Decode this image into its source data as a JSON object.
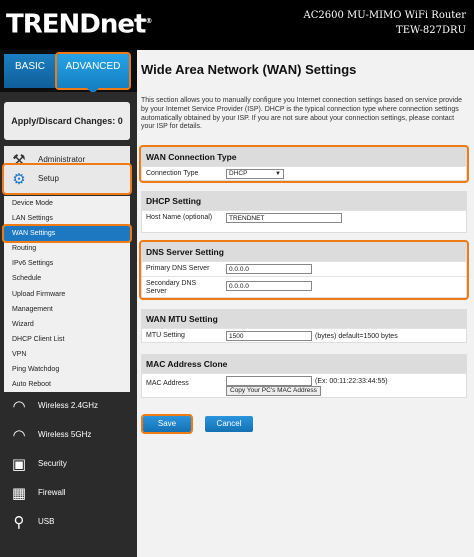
{
  "header": {
    "logo": "TRENDnet",
    "model_name": "AC2600 MU-MIMO WiFi Router",
    "model_number": "TEW-827DRU"
  },
  "tabs": {
    "basic": "BASIC",
    "advanced": "ADVANCED"
  },
  "sidebar": {
    "apply_label": "Apply/Discard Changes: 0",
    "administrator": "Administrator",
    "setup": "Setup",
    "setup_items": [
      "Device Mode",
      "LAN Settings",
      "WAN Settings",
      "Routing",
      "IPv6 Settings",
      "Schedule",
      "Upload Firmware",
      "Management",
      "Wizard",
      "DHCP Client List",
      "VPN",
      "Ping Watchdog",
      "Auto Reboot"
    ],
    "active_item": "WAN Settings",
    "wireless24": "Wireless 2.4GHz",
    "wireless5": "Wireless 5GHz",
    "security": "Security",
    "firewall": "Firewall",
    "usb": "USB"
  },
  "main": {
    "title": "Wide Area Network (WAN) Settings",
    "description": "This section allows you to manually configure you Internet connection settings based on service provide by your Internet Service Provider (ISP). DHCP is the typical connection type where connection settings automatically obtained by your ISP. If you are not sure about your connection settings, please contact your ISP for details.",
    "wan_type": {
      "heading": "WAN Connection Type",
      "label": "Connection Type",
      "value": "DHCP"
    },
    "dhcp": {
      "heading": "DHCP Setting",
      "host_label": "Host Name (optional)",
      "host_value": "TRENDNET"
    },
    "dns": {
      "heading": "DNS Server Setting",
      "primary_label": "Primary DNS Server",
      "primary_value": "0.0.0.0",
      "secondary_label": "Secondary DNS Server",
      "secondary_value": "0.0.0.0"
    },
    "mtu": {
      "heading": "WAN MTU Setting",
      "label": "MTU Setting",
      "value": "1500",
      "suffix": "(bytes) default=1500 bytes"
    },
    "mac": {
      "heading": "MAC Address Clone",
      "label": "MAC Address",
      "value": "",
      "example": "(Ex: 00:11:22:33:44:55)",
      "copy_button": "Copy Your PC's MAC Address"
    },
    "save_label": "Save",
    "cancel_label": "Cancel"
  },
  "colors": {
    "accent": "#1d78c1",
    "highlight": "#f07a14"
  }
}
